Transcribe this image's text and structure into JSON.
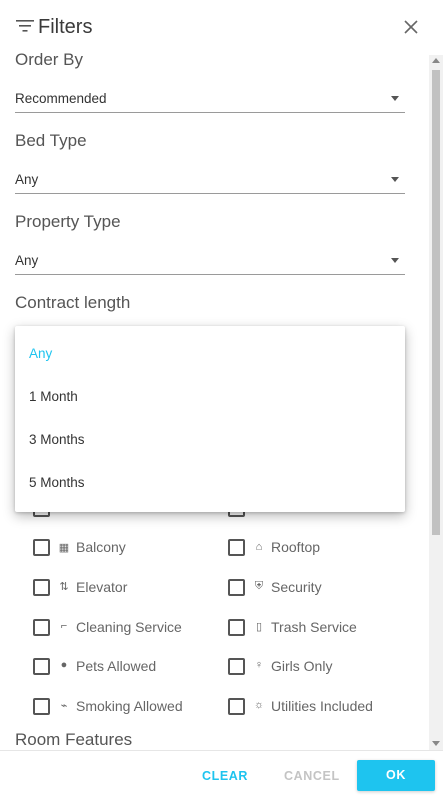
{
  "header": {
    "title": "Filters"
  },
  "sections": {
    "order_by": {
      "label": "Order By",
      "value": "Recommended"
    },
    "bed_type": {
      "label": "Bed Type",
      "value": "Any"
    },
    "property_type": {
      "label": "Property Type",
      "value": "Any"
    },
    "contract_length": {
      "label": "Contract length"
    },
    "room_features": {
      "label": "Room Features"
    }
  },
  "dropdown": {
    "options": [
      "Any",
      "1 Month",
      "3 Months",
      "5 Months"
    ],
    "selected": "Any"
  },
  "amenities": {
    "balcony": "Balcony",
    "rooftop": "Rooftop",
    "elevator": "Elevator",
    "security": "Security",
    "cleaning": "Cleaning Service",
    "trash": "Trash Service",
    "pets": "Pets Allowed",
    "girls": "Girls Only",
    "smoking": "Smoking Allowed",
    "utilities": "Utilities Included"
  },
  "footer": {
    "clear": "CLEAR",
    "cancel": "CANCEL",
    "ok": "OK"
  },
  "colors": {
    "accent": "#1ec4ef"
  }
}
